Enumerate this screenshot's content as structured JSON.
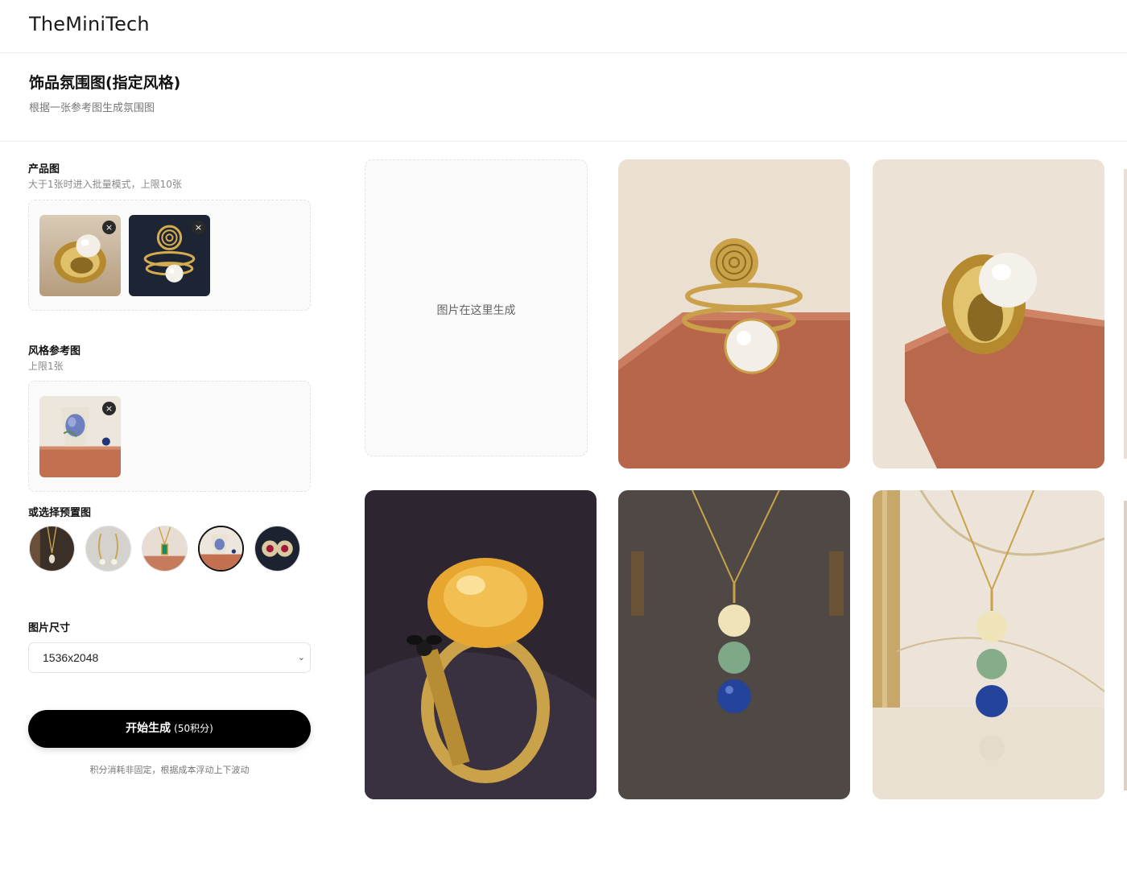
{
  "app": {
    "brand": "TheMiniTech"
  },
  "page": {
    "title": "饰品氛围图(指定风格)",
    "subtitle": "根据一张参考图生成氛围图"
  },
  "product": {
    "label": "产品图",
    "hint": "大于1张时进入批量模式，上限10张",
    "images": [
      {
        "name": "gold-pearl-ring",
        "remove": "×"
      },
      {
        "name": "spiral-pearl-ring",
        "remove": "×"
      }
    ]
  },
  "style": {
    "label": "风格参考图",
    "hint": "上限1张",
    "images": [
      {
        "name": "vase-on-brick",
        "remove": "×"
      }
    ]
  },
  "presets": {
    "label": "或选择预置图",
    "items": [
      "pendant-dark",
      "earrings-light",
      "emerald-pendant",
      "vase-on-brick",
      "ruby-earrings"
    ],
    "selected_index": 3
  },
  "size": {
    "label": "图片尺寸",
    "value": "1536x2048"
  },
  "generate": {
    "label": "开始生成",
    "cost": "(50积分)",
    "note": "积分消耗非固定，根据成本浮动上下波动"
  },
  "output": {
    "placeholder": "图片在这里生成",
    "results": [
      "spiral-ring-on-brick",
      "pearl-ring-on-brick",
      "citrine-bee-ring",
      "bead-pendant-dark-gallery",
      "bead-pendant-marble"
    ]
  },
  "colors": {
    "button_bg": "#000000",
    "accent_gold": "#c9a24a",
    "brick": "#b9694b"
  }
}
